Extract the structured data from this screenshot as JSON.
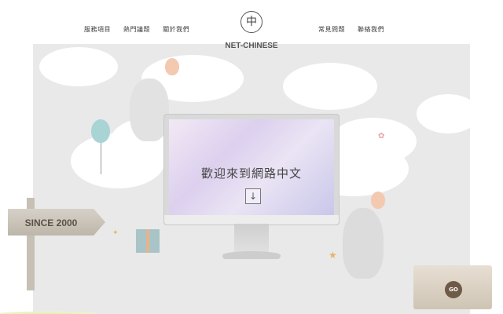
{
  "header": {
    "nav_left": [
      "服務項目",
      "熱門議題",
      "關於我們"
    ],
    "nav_right": [
      "常見問題",
      "聯絡我們"
    ],
    "logo": {
      "mark": "中",
      "text": "NET-CHINESE"
    }
  },
  "hero": {
    "title": "歡迎來到網路中文",
    "scroll_button": "↓"
  },
  "signs": {
    "since": "SINCE 2000",
    "go": "GO"
  },
  "colors": {
    "background": "#e9e9e9",
    "screen_gradient": [
      "#f2e9f5",
      "#dcd0ee",
      "#c9c7ea"
    ],
    "balloon_blue": "#a8d4d6",
    "balloon_peach": "#f3c9b0"
  },
  "icons": [
    "logo-mark",
    "arrow-down-icon",
    "paw-icon"
  ]
}
